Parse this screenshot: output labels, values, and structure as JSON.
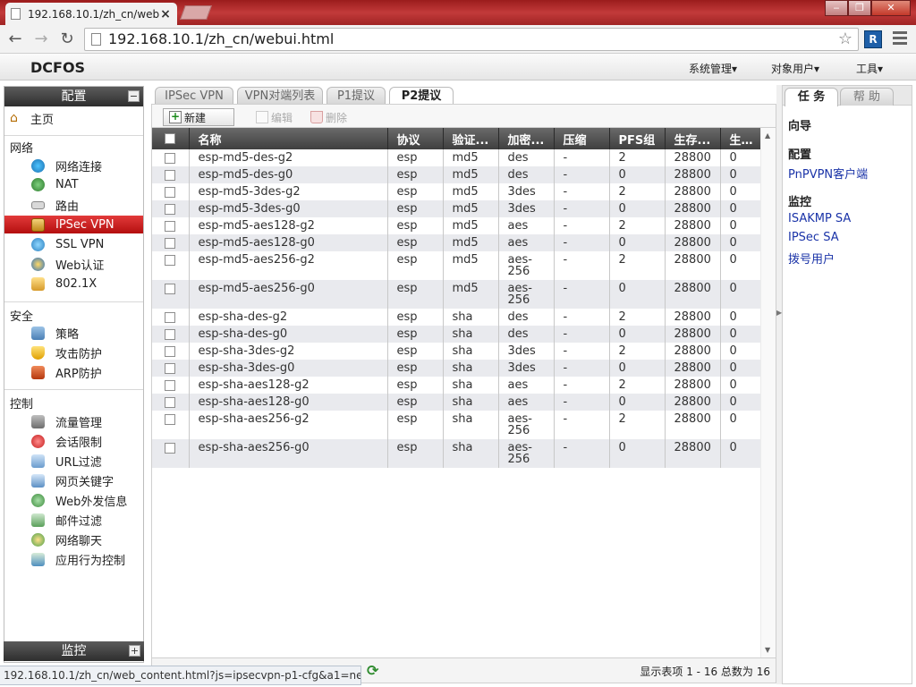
{
  "browser": {
    "tab_title": "192.168.10.1/zh_cn/web",
    "tab_close": "×",
    "back": "←",
    "forward": "→",
    "reload": "↻",
    "url": "192.168.10.1/zh_cn/webui.html",
    "bookmark": "☆",
    "status_url": "192.168.10.1/zh_cn/web_content.html?js=ipsecvpn-p1-cfg&a1=new#"
  },
  "header": {
    "logo": "DCFOS",
    "menus": [
      "系统管理▾",
      "对象用户▾",
      "工具▾"
    ]
  },
  "sidebar": {
    "title": "配置",
    "collapse": "−",
    "home": "主页",
    "groups": [
      {
        "label": "网络",
        "items": [
          "网络连接",
          "NAT",
          "路由",
          "IPSec VPN",
          "SSL VPN",
          "Web认证",
          "802.1X"
        ]
      },
      {
        "label": "安全",
        "items": [
          "策略",
          "攻击防护",
          "ARP防护"
        ]
      },
      {
        "label": "控制",
        "items": [
          "流量管理",
          "会话限制",
          "URL过滤",
          "网页关键字",
          "Web外发信息",
          "邮件过滤",
          "网络聊天",
          "应用行为控制"
        ]
      }
    ],
    "active_item": "IPSec VPN",
    "monitor_title": "监控",
    "monitor_expand": "+"
  },
  "main": {
    "tabs": [
      "IPSec VPN",
      "VPN对端列表",
      "P1提议",
      "P2提议"
    ],
    "active_tab": "P2提议",
    "toolbar": {
      "new": "新建",
      "edit": "编辑",
      "delete": "删除"
    },
    "columns": [
      "名称",
      "协议",
      "验证...",
      "加密...",
      "压缩",
      "PFS组",
      "生存...",
      "生存..."
    ],
    "rows": [
      [
        "esp-md5-des-g2",
        "esp",
        "md5",
        "des",
        "-",
        "2",
        "28800",
        "0"
      ],
      [
        "esp-md5-des-g0",
        "esp",
        "md5",
        "des",
        "-",
        "0",
        "28800",
        "0"
      ],
      [
        "esp-md5-3des-g2",
        "esp",
        "md5",
        "3des",
        "-",
        "2",
        "28800",
        "0"
      ],
      [
        "esp-md5-3des-g0",
        "esp",
        "md5",
        "3des",
        "-",
        "0",
        "28800",
        "0"
      ],
      [
        "esp-md5-aes128-g2",
        "esp",
        "md5",
        "aes",
        "-",
        "2",
        "28800",
        "0"
      ],
      [
        "esp-md5-aes128-g0",
        "esp",
        "md5",
        "aes",
        "-",
        "0",
        "28800",
        "0"
      ],
      [
        "esp-md5-aes256-g2",
        "esp",
        "md5",
        "aes-\n256",
        "-",
        "2",
        "28800",
        "0"
      ],
      [
        "esp-md5-aes256-g0",
        "esp",
        "md5",
        "aes-\n256",
        "-",
        "0",
        "28800",
        "0"
      ],
      [
        "esp-sha-des-g2",
        "esp",
        "sha",
        "des",
        "-",
        "2",
        "28800",
        "0"
      ],
      [
        "esp-sha-des-g0",
        "esp",
        "sha",
        "des",
        "-",
        "0",
        "28800",
        "0"
      ],
      [
        "esp-sha-3des-g2",
        "esp",
        "sha",
        "3des",
        "-",
        "2",
        "28800",
        "0"
      ],
      [
        "esp-sha-3des-g0",
        "esp",
        "sha",
        "3des",
        "-",
        "0",
        "28800",
        "0"
      ],
      [
        "esp-sha-aes128-g2",
        "esp",
        "sha",
        "aes",
        "-",
        "2",
        "28800",
        "0"
      ],
      [
        "esp-sha-aes128-g0",
        "esp",
        "sha",
        "aes",
        "-",
        "0",
        "28800",
        "0"
      ],
      [
        "esp-sha-aes256-g2",
        "esp",
        "sha",
        "aes-\n256",
        "-",
        "2",
        "28800",
        "0"
      ],
      [
        "esp-sha-aes256-g0",
        "esp",
        "sha",
        "aes-\n256",
        "-",
        "0",
        "28800",
        "0"
      ]
    ],
    "page_info": "显示表项 1 - 16 总数为 16"
  },
  "right_panel": {
    "tabs": [
      "任 务",
      "帮 助"
    ],
    "active_tab": "任 务",
    "wizard": "向导",
    "config_head": "配置",
    "config_links": [
      "PnPVPN客户端"
    ],
    "monitor_head": "监控",
    "monitor_links": [
      "ISAKMP SA",
      "IPSec SA",
      "拨号用户"
    ]
  },
  "colors": {
    "accent": "#c81e1e",
    "link": "#1a33a8",
    "header_dark": "#3f3f3f"
  }
}
